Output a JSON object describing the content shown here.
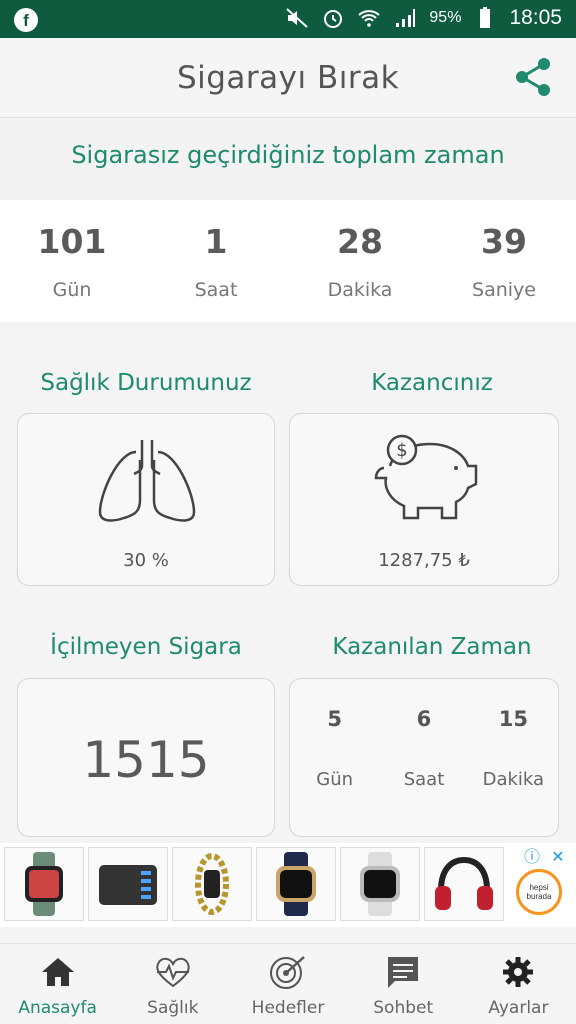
{
  "status_bar": {
    "battery_percent": "95%",
    "time": "18:05",
    "icons": [
      "facebook-icon",
      "mute-icon",
      "alarm-icon",
      "wifi-icon",
      "signal-icon",
      "battery-icon"
    ]
  },
  "app_bar": {
    "title": "Sigarayı Bırak",
    "share_icon": "share-icon"
  },
  "banner": {
    "text": "Sigarasız geçirdiğiniz toplam zaman"
  },
  "counter": [
    {
      "value": "101",
      "label": "Gün"
    },
    {
      "value": "1",
      "label": "Saat"
    },
    {
      "value": "28",
      "label": "Dakika"
    },
    {
      "value": "39",
      "label": "Saniye"
    }
  ],
  "health": {
    "title": "Sağlık Durumunuz",
    "value": "30 %",
    "icon": "lungs-icon"
  },
  "savings": {
    "title": "Kazancınız",
    "value": "1287,75 ₺",
    "icon": "piggy-bank-icon"
  },
  "cigarettes": {
    "title": "İçilmeyen Sigara",
    "value": "1515"
  },
  "time_gained": {
    "title": "Kazanılan Zaman",
    "items": [
      {
        "value": "5",
        "label": "Gün"
      },
      {
        "value": "6",
        "label": "Saat"
      },
      {
        "value": "15",
        "label": "Dakika"
      }
    ]
  },
  "ads": {
    "brand": [
      "hepsi",
      "burada"
    ],
    "info_icon": "ⓘ",
    "close_icon": "✕"
  },
  "bottom_nav": [
    {
      "label": "Anasayfa",
      "icon": "home-icon",
      "active": true
    },
    {
      "label": "Sağlık",
      "icon": "heartbeat-icon",
      "active": false
    },
    {
      "label": "Hedefler",
      "icon": "target-icon",
      "active": false
    },
    {
      "label": "Sohbet",
      "icon": "chat-icon",
      "active": false
    },
    {
      "label": "Ayarlar",
      "icon": "gear-icon",
      "active": false
    }
  ],
  "colors": {
    "primary": "#0f5b3f",
    "accent": "#1e8a6e"
  }
}
